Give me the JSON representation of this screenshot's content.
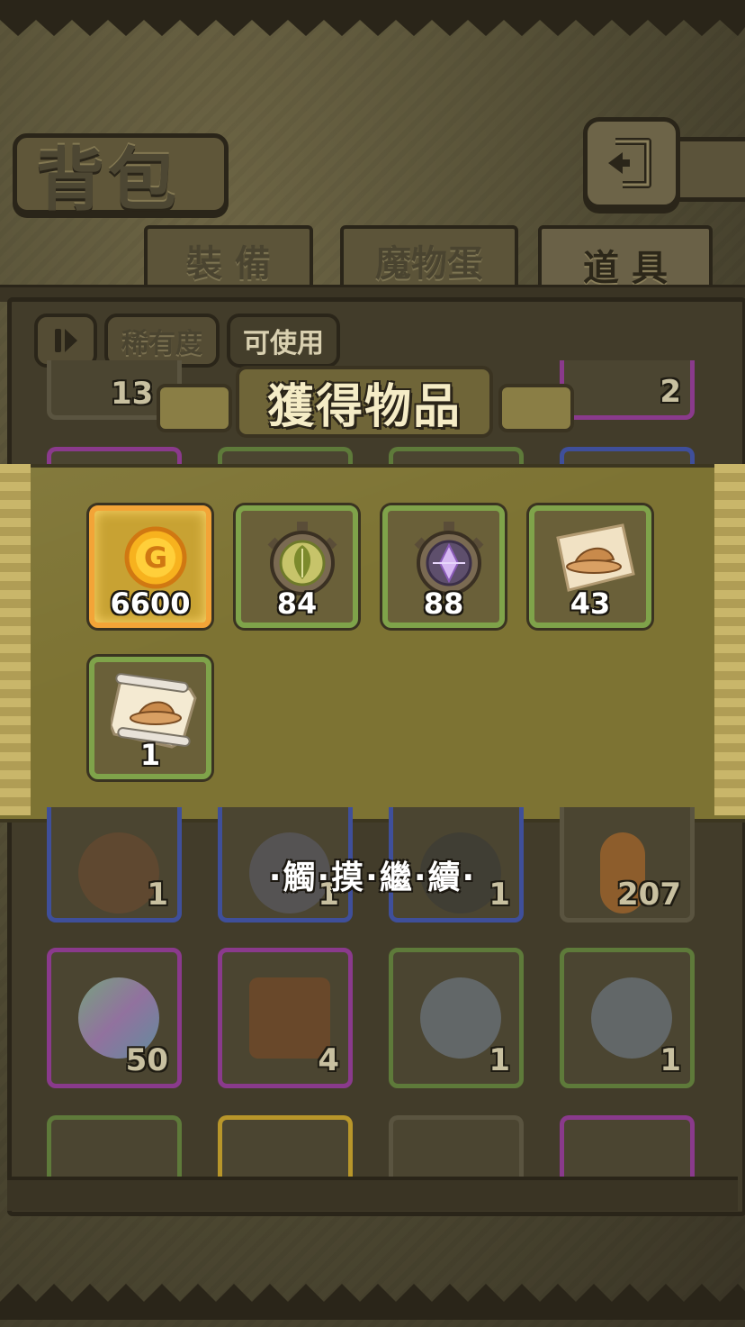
{
  "header": {
    "title": "背包",
    "back_icon": "return-arrow-icon"
  },
  "tabs": [
    {
      "label": "裝 備"
    },
    {
      "label": "魔物蛋"
    },
    {
      "label": "道 具"
    }
  ],
  "filters": {
    "sort_icon": "sort-toggle-icon",
    "rarity_label": "稀有度",
    "usable_label": "可使用"
  },
  "background_grid": {
    "top_partial": [
      {
        "count": "13"
      },
      {
        "count": "2"
      }
    ],
    "row_a": [
      {
        "count": "1",
        "icon": "monster-card-icon",
        "rarity": "blue"
      },
      {
        "count": "1",
        "icon": "monster-card-icon",
        "rarity": "blue"
      },
      {
        "count": "1",
        "icon": "monster-card-icon",
        "rarity": "blue"
      },
      {
        "count": "207",
        "icon": "bread-icon",
        "rarity": "gray"
      }
    ],
    "row_b": [
      {
        "count": "50",
        "icon": "rainbow-egg-icon",
        "rarity": "purple"
      },
      {
        "count": "4",
        "icon": "treasure-chest-icon",
        "rarity": "purple"
      },
      {
        "count": "1",
        "icon": "knight-figurine-icon",
        "rarity": "green"
      },
      {
        "count": "1",
        "icon": "knight-figurine-icon",
        "rarity": "green"
      }
    ]
  },
  "reward_popup": {
    "title": "獲得物品",
    "items": [
      {
        "icon": "gold-coin-icon",
        "count": "6600",
        "rarity": "gold"
      },
      {
        "icon": "green-leaf-emblem-icon",
        "count": "84",
        "rarity": "green"
      },
      {
        "icon": "purple-crystal-emblem-icon",
        "count": "88",
        "rarity": "green"
      },
      {
        "icon": "hat-map-icon",
        "count": "43",
        "rarity": "green"
      },
      {
        "icon": "hat-scroll-icon",
        "count": "1",
        "rarity": "green"
      }
    ],
    "continue_text": "·觸·摸·繼·續·"
  },
  "colors": {
    "gold_border": "#f3a437",
    "green_border": "#7fa34a",
    "blue_border": "#3f4f9a",
    "purple_border": "#8a3a8c",
    "band": "#7d7333"
  }
}
